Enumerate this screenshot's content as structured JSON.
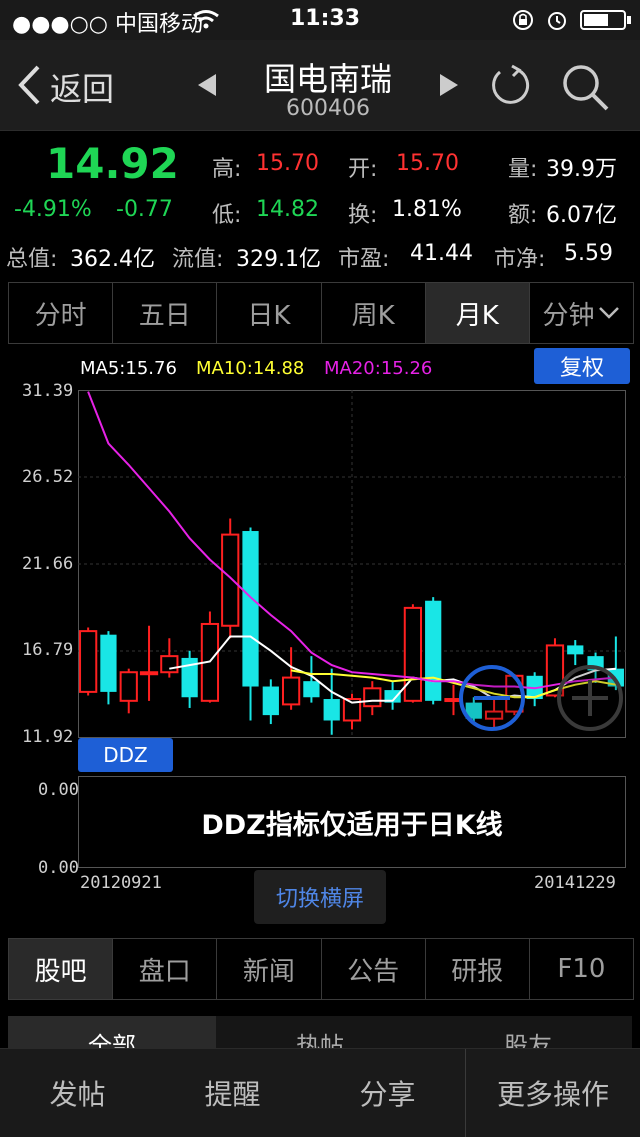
{
  "status_bar": {
    "carrier": "●●●○○ 中国移动",
    "time": "11:33"
  },
  "nav": {
    "back_label": "返回",
    "stock_name": "国电南瑞",
    "stock_code": "600406"
  },
  "quote": {
    "price": "14.92",
    "change_pct": "-4.91%",
    "change": "-0.77",
    "high_label": "高:",
    "high": "15.70",
    "low_label": "低:",
    "low": "14.82",
    "open_label": "开:",
    "open": "15.70",
    "turnover_label": "换:",
    "turnover": "1.81%",
    "volume_label": "量:",
    "volume": "39.9万",
    "amount_label": "额:",
    "amount": "6.07亿",
    "total_cap_label": "总值:",
    "total_cap": "362.4亿",
    "float_cap_label": "流值:",
    "float_cap": "329.1亿",
    "pe_label": "市盈:",
    "pe": "41.44",
    "pb_label": "市净:",
    "pb": "5.59"
  },
  "chart_tabs": [
    {
      "label": "分时"
    },
    {
      "label": "五日"
    },
    {
      "label": "日K"
    },
    {
      "label": "周K"
    },
    {
      "label": "月K"
    },
    {
      "label": "分钟"
    }
  ],
  "ma": {
    "ma5": "MA5:15.76",
    "ma10": "MA10:14.88",
    "ma20": "MA20:15.26"
  },
  "fuquan_label": "复权",
  "ddz_label": "DDZ",
  "ddz_message": "DDZ指标仅适用于日K线",
  "switch_landscape_label": "切换横屏",
  "colors": {
    "up": "#ff2020",
    "down": "#19e6e6",
    "ma5": "#ffffff",
    "ma10": "#ffff33",
    "ma20": "#e622e6",
    "accent": "#1e5fd6"
  },
  "chart_data": {
    "type": "candlestick",
    "ylim": [
      11.92,
      31.39
    ],
    "y_ticks": [
      "31.39",
      "26.52",
      "21.66",
      "16.79",
      "11.92"
    ],
    "x_start_label": "20120921",
    "x_end_label": "20141229",
    "ddz_ticks": [
      "0.00",
      "0.00"
    ],
    "candles": [
      {
        "open": 14.5,
        "close": 17.9,
        "high": 18.1,
        "low": 14.3
      },
      {
        "open": 17.7,
        "close": 14.5,
        "high": 17.9,
        "low": 13.8
      },
      {
        "open": 14.0,
        "close": 15.6,
        "high": 15.8,
        "low": 13.3
      },
      {
        "open": 15.5,
        "close": 15.6,
        "high": 18.2,
        "low": 14.0
      },
      {
        "open": 15.6,
        "close": 16.5,
        "high": 17.5,
        "low": 15.3
      },
      {
        "open": 16.4,
        "close": 14.2,
        "high": 16.8,
        "low": 13.6
      },
      {
        "open": 14.0,
        "close": 18.3,
        "high": 19.0,
        "low": 13.9
      },
      {
        "open": 18.2,
        "close": 23.3,
        "high": 24.2,
        "low": 17.5
      },
      {
        "open": 23.5,
        "close": 14.8,
        "high": 23.7,
        "low": 12.9
      },
      {
        "open": 14.8,
        "close": 13.2,
        "high": 15.2,
        "low": 12.7
      },
      {
        "open": 13.8,
        "close": 15.3,
        "high": 17.0,
        "low": 13.5
      },
      {
        "open": 15.1,
        "close": 14.2,
        "high": 16.5,
        "low": 13.9
      },
      {
        "open": 14.1,
        "close": 12.9,
        "high": 15.8,
        "low": 12.1
      },
      {
        "open": 12.9,
        "close": 14.1,
        "high": 14.4,
        "low": 12.4
      },
      {
        "open": 13.7,
        "close": 14.7,
        "high": 15.1,
        "low": 13.2
      },
      {
        "open": 14.6,
        "close": 13.9,
        "high": 15.1,
        "low": 13.5
      },
      {
        "open": 14.0,
        "close": 19.2,
        "high": 19.4,
        "low": 13.9
      },
      {
        "open": 19.6,
        "close": 14.0,
        "high": 19.8,
        "low": 13.8
      },
      {
        "open": 14.0,
        "close": 14.1,
        "high": 14.9,
        "low": 13.2
      },
      {
        "open": 13.9,
        "close": 13.0,
        "high": 14.2,
        "low": 12.7
      },
      {
        "open": 13.0,
        "close": 13.4,
        "high": 14.2,
        "low": 12.5
      },
      {
        "open": 13.4,
        "close": 15.4,
        "high": 15.5,
        "low": 13.2
      },
      {
        "open": 15.4,
        "close": 14.1,
        "high": 15.6,
        "low": 13.7
      },
      {
        "open": 14.3,
        "close": 17.1,
        "high": 17.5,
        "low": 14.2
      },
      {
        "open": 17.1,
        "close": 16.6,
        "high": 17.4,
        "low": 16.0
      },
      {
        "open": 16.5,
        "close": 15.7,
        "high": 16.7,
        "low": 15.0
      },
      {
        "open": 15.8,
        "close": 14.8,
        "high": 17.6,
        "low": 14.6
      }
    ],
    "series": [
      {
        "name": "MA5",
        "values": [
          null,
          null,
          null,
          null,
          15.8,
          16.0,
          16.2,
          17.6,
          17.6,
          16.8,
          15.9,
          15.4,
          14.5,
          13.9,
          14.0,
          14.0,
          15.3,
          15.1,
          15.2,
          14.8,
          14.1,
          14.3,
          14.2,
          14.6,
          15.3,
          15.7,
          15.8
        ]
      },
      {
        "name": "MA10",
        "values": [
          null,
          null,
          null,
          null,
          null,
          null,
          null,
          null,
          null,
          null,
          15.7,
          15.5,
          15.5,
          15.4,
          15.3,
          15.1,
          15.2,
          15.3,
          15.0,
          14.7,
          14.4,
          14.2,
          14.2,
          14.6,
          14.9,
          15.1,
          14.9
        ]
      },
      {
        "name": "MA20",
        "values": [
          31.3,
          28.4,
          27.2,
          25.9,
          24.6,
          23.1,
          21.9,
          20.9,
          19.8,
          18.8,
          17.9,
          16.7,
          16.0,
          15.6,
          15.5,
          15.4,
          15.3,
          15.1,
          15.1,
          14.9,
          14.8,
          14.8,
          14.7,
          14.9,
          15.1,
          15.2,
          15.3
        ]
      }
    ]
  },
  "sub_tabs": [
    {
      "label": "股吧"
    },
    {
      "label": "盘口"
    },
    {
      "label": "新闻"
    },
    {
      "label": "公告"
    },
    {
      "label": "研报"
    },
    {
      "label": "F10"
    }
  ],
  "forum_tabs": [
    {
      "label": "全部"
    },
    {
      "label": "热帖"
    },
    {
      "label": "股友"
    }
  ],
  "bottom_bar": [
    {
      "label": "发帖"
    },
    {
      "label": "提醒"
    },
    {
      "label": "分享"
    },
    {
      "label": "更多操作"
    }
  ]
}
